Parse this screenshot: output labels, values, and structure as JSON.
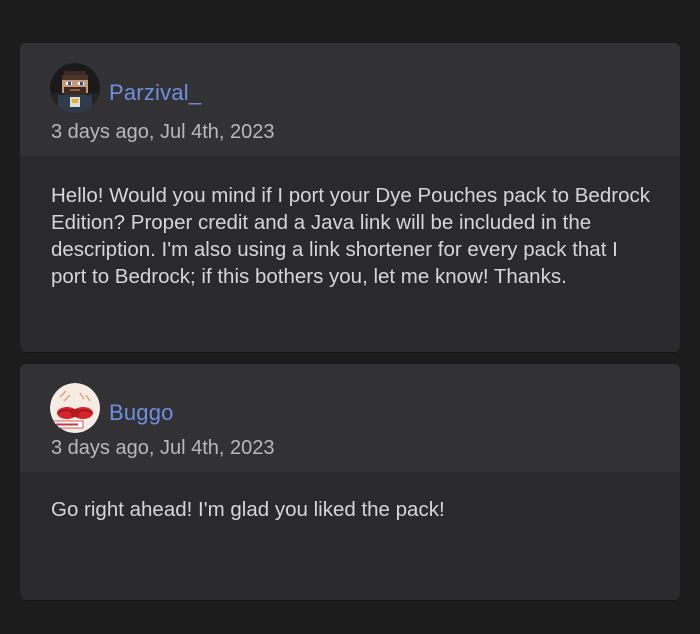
{
  "comments": [
    {
      "username": "Parzival_",
      "timestamp": "3 days ago, Jul 4th, 2023",
      "text": "Hello! Would you mind if I port your Dye Pouches pack to Bedrock Edition? Proper credit and a Java link will be included in the description. I'm also using a link shortener for every pack that I port to Bedrock; if this bothers you, let me know! Thanks.",
      "avatar_icon": "pixel-character-avatar"
    },
    {
      "username": "Buggo",
      "timestamp": "3 days ago, Jul 4th, 2023",
      "text": "Go right ahead! I'm glad you liked the pack!",
      "avatar_icon": "red-bow-avatar"
    }
  ],
  "colors": {
    "page_background": "#1c1c1d",
    "card_header": "#323234",
    "card_body": "#2a2a2c",
    "username": "#6f8fe0",
    "timestamp": "#b9b9bb",
    "text": "#d6d6d8"
  }
}
